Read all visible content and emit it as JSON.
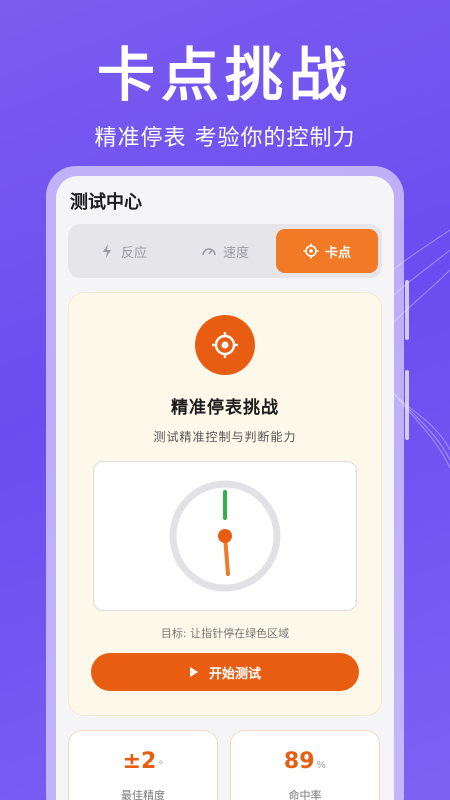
{
  "hero": {
    "title": "卡点挑战",
    "subtitle": "精准停表 考验你的控制力"
  },
  "screen": {
    "title": "测试中心"
  },
  "tabs": [
    {
      "label": "反应",
      "icon": "bolt-icon",
      "active": false
    },
    {
      "label": "速度",
      "icon": "speedometer-icon",
      "active": false
    },
    {
      "label": "卡点",
      "icon": "target-icon",
      "active": true
    }
  ],
  "challenge": {
    "icon": "crosshair-icon",
    "title": "精准停表挑战",
    "description": "测试精准控制与判断能力",
    "goal": "目标: 让指针停在绿色区域",
    "start_label": "开始测试"
  },
  "stats": [
    {
      "value": "±2",
      "unit": "°",
      "label": "最佳精度"
    },
    {
      "value": "89",
      "unit": "%",
      "label": "命中率"
    }
  ],
  "colors": {
    "accent": "#e85d12",
    "tab_active": "#f07a25",
    "target_zone": "#2fb34a",
    "background": "#6a4df0"
  }
}
